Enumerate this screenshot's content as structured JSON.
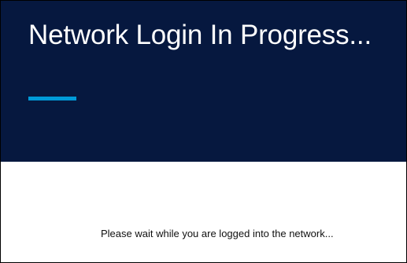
{
  "header": {
    "title": "Network Login In Progress...",
    "background_color": "#06183f",
    "accent_color": "#009ad8"
  },
  "main": {
    "message": "Please wait while you are logged into the network..."
  }
}
